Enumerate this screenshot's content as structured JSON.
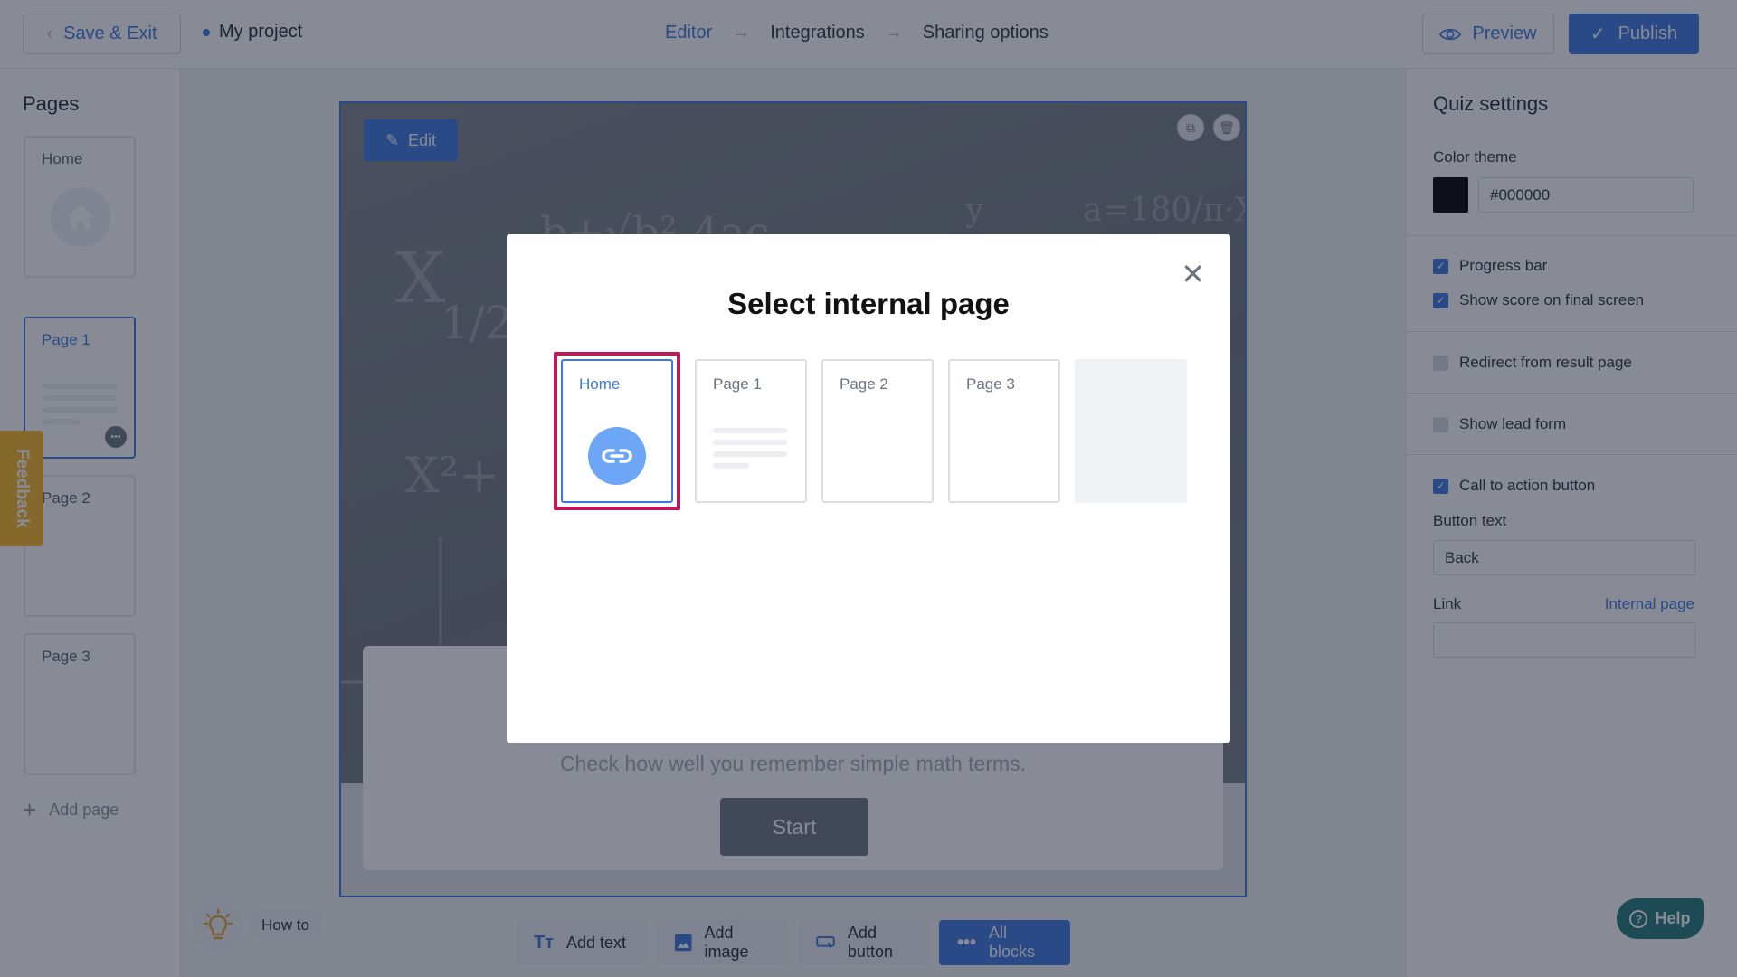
{
  "header": {
    "save_exit_label": "Save & Exit",
    "project_name": "My project",
    "steps": [
      "Editor",
      "Integrations",
      "Sharing options"
    ],
    "active_step": "Editor",
    "preview_label": "Preview",
    "publish_label": "Publish"
  },
  "pages_panel": {
    "title": "Pages",
    "pages": [
      {
        "label": "Home",
        "icon": "home-icon"
      },
      {
        "label": "Page 1",
        "selected": true
      },
      {
        "label": "Page 2"
      },
      {
        "label": "Page 3"
      }
    ],
    "add_page_label": "Add page",
    "feedback_label": "Feedback"
  },
  "canvas": {
    "edit_label": "Edit",
    "subtitle": "Check how well you remember simple math terms.",
    "start_label": "Start"
  },
  "toolbar": {
    "add_text": "Add text",
    "add_image": "Add image",
    "add_button": "Add button",
    "all_blocks": "All blocks",
    "how_to": "How to"
  },
  "settings": {
    "title": "Quiz settings",
    "color_theme_label": "Color theme",
    "color_theme_value": "#000000",
    "progress_bar": {
      "label": "Progress bar",
      "checked": true
    },
    "show_score": {
      "label": "Show score on final screen",
      "checked": true
    },
    "redirect": {
      "label": "Redirect from result page",
      "checked": false
    },
    "lead_form": {
      "label": "Show lead form",
      "checked": false
    },
    "cta": {
      "label": "Call to action button",
      "checked": true
    },
    "button_text_label": "Button text",
    "button_text_value": "Back",
    "link_label": "Link",
    "link_type": "Internal page",
    "link_value": ""
  },
  "help_label": "Help",
  "modal": {
    "title": "Select internal page",
    "options": [
      "Home",
      "Page 1",
      "Page 2",
      "Page 3"
    ],
    "selected": "Home"
  },
  "colors": {
    "accent": "#3a78e0",
    "selection_highlight": "#c2185b",
    "feedback": "#f8b824",
    "help": "#1f7a7a"
  }
}
